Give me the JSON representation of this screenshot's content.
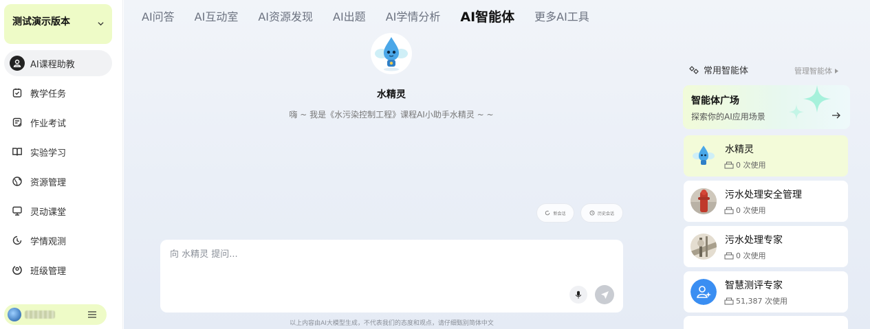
{
  "sidebar": {
    "version_label": "测试演示版本",
    "items": [
      {
        "label": "AI课程助教",
        "icon": "ai-assistant-icon",
        "active": true
      },
      {
        "label": "教学任务",
        "icon": "task-icon",
        "active": false
      },
      {
        "label": "作业考试",
        "icon": "exam-icon",
        "active": false
      },
      {
        "label": "实验学习",
        "icon": "book-icon",
        "active": false
      },
      {
        "label": "资源管理",
        "icon": "globe-icon",
        "active": false
      },
      {
        "label": "灵动课堂",
        "icon": "monitor-icon",
        "active": false
      },
      {
        "label": "学情观测",
        "icon": "observe-icon",
        "active": false
      },
      {
        "label": "班级管理",
        "icon": "class-icon",
        "active": false
      }
    ]
  },
  "topnav": {
    "tabs": [
      "AI问答",
      "AI互动室",
      "AI资源发现",
      "AI出题",
      "AI学情分析",
      "AI智能体",
      "更多AI工具"
    ],
    "active": "AI智能体"
  },
  "agent": {
    "name": "水精灵",
    "description": "嗨 ~ 我是《水污染控制工程》课程AI小助手水精灵 ~ ~"
  },
  "chat": {
    "new_chat": "新会话",
    "history": "历史会话",
    "placeholder": "向 水精灵 提问...",
    "disclaimer": "以上内容由AI大模型生成，不代表我们的态度和观点，请仔细甄别简体中文"
  },
  "right_panel": {
    "title": "常用智能体",
    "manage": "管理智能体",
    "plaza_title": "智能体广场",
    "plaza_subtitle": "探索你的AI应用场景",
    "agents": [
      {
        "name": "水精灵",
        "uses": "0 次使用",
        "active": true
      },
      {
        "name": "污水处理安全管理",
        "uses": "0 次使用",
        "active": false
      },
      {
        "name": "污水处理专家",
        "uses": "0 次使用",
        "active": false
      },
      {
        "name": "智慧测评专家",
        "uses": "51,387 次使用",
        "active": false
      }
    ]
  },
  "colors": {
    "accent_lime": "#d9f56a",
    "active_card": "#f3fbd9",
    "eval_blue": "#3a8ef2"
  }
}
